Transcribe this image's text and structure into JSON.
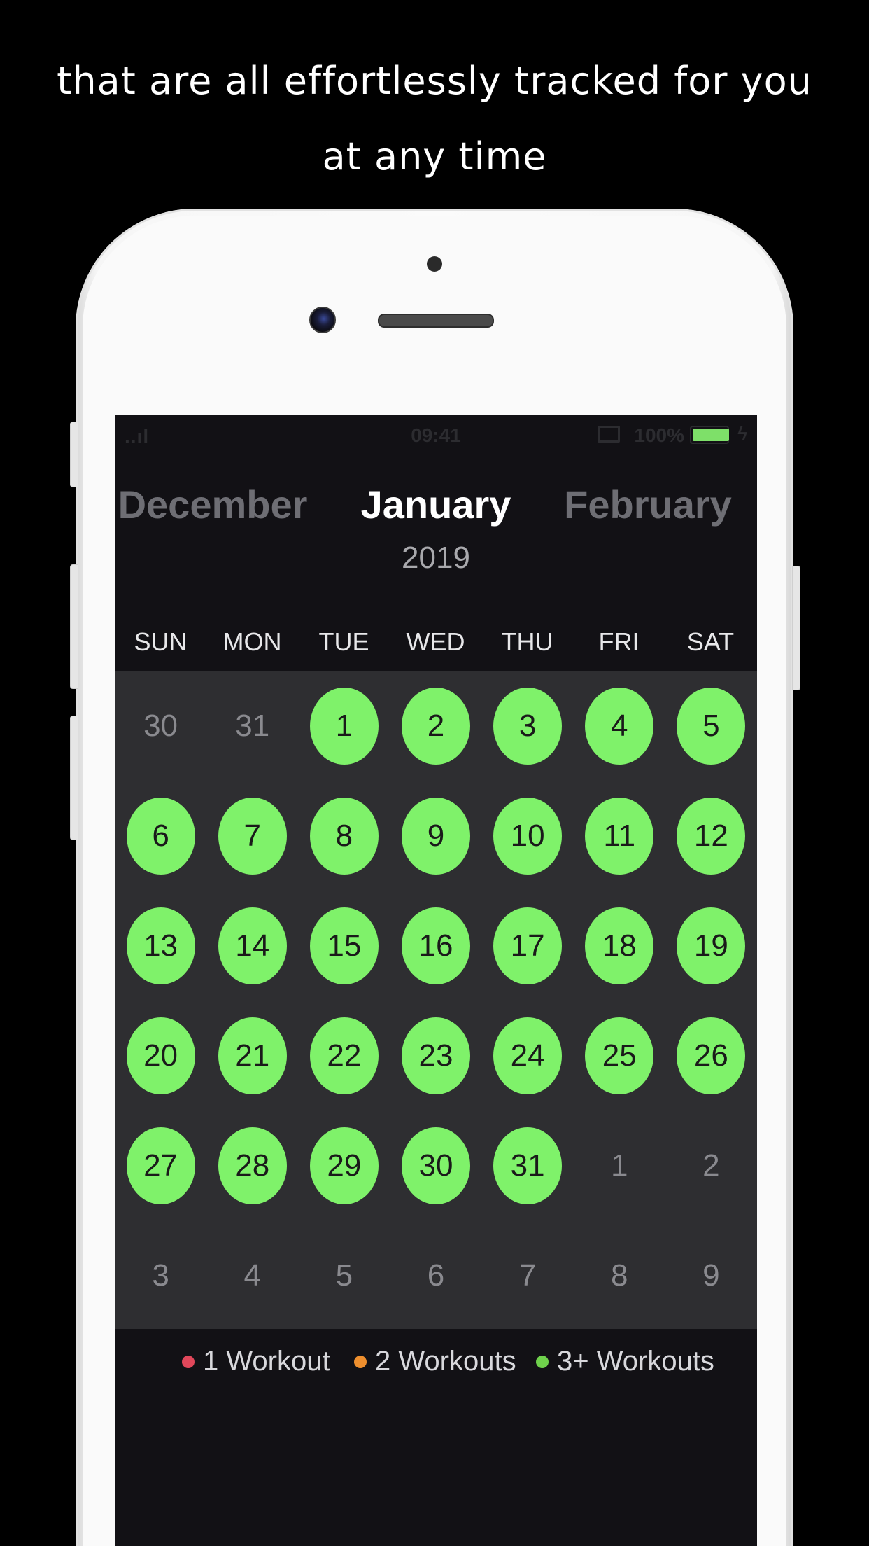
{
  "caption": {
    "line1": "that are all effortlessly tracked for you",
    "line2": "at any time"
  },
  "status_bar": {
    "signal": "..ıl",
    "time": "09:41",
    "battery": "100%"
  },
  "header": {
    "prev_month": "December",
    "current_month": "January",
    "next_month": "February",
    "year": "2019"
  },
  "weekdays": [
    "SUN",
    "MON",
    "TUE",
    "WED",
    "THU",
    "FRI",
    "SAT"
  ],
  "days": [
    {
      "label": "30",
      "active": false
    },
    {
      "label": "31",
      "active": false
    },
    {
      "label": "1",
      "active": true
    },
    {
      "label": "2",
      "active": true
    },
    {
      "label": "3",
      "active": true
    },
    {
      "label": "4",
      "active": true
    },
    {
      "label": "5",
      "active": true
    },
    {
      "label": "6",
      "active": true
    },
    {
      "label": "7",
      "active": true
    },
    {
      "label": "8",
      "active": true
    },
    {
      "label": "9",
      "active": true
    },
    {
      "label": "10",
      "active": true
    },
    {
      "label": "11",
      "active": true
    },
    {
      "label": "12",
      "active": true
    },
    {
      "label": "13",
      "active": true
    },
    {
      "label": "14",
      "active": true
    },
    {
      "label": "15",
      "active": true
    },
    {
      "label": "16",
      "active": true
    },
    {
      "label": "17",
      "active": true
    },
    {
      "label": "18",
      "active": true
    },
    {
      "label": "19",
      "active": true
    },
    {
      "label": "20",
      "active": true
    },
    {
      "label": "21",
      "active": true
    },
    {
      "label": "22",
      "active": true
    },
    {
      "label": "23",
      "active": true
    },
    {
      "label": "24",
      "active": true
    },
    {
      "label": "25",
      "active": true
    },
    {
      "label": "26",
      "active": true
    },
    {
      "label": "27",
      "active": true
    },
    {
      "label": "28",
      "active": true
    },
    {
      "label": "29",
      "active": true
    },
    {
      "label": "30",
      "active": true
    },
    {
      "label": "31",
      "active": true
    },
    {
      "label": "1",
      "active": false
    },
    {
      "label": "2",
      "active": false
    },
    {
      "label": "3",
      "active": false
    },
    {
      "label": "4",
      "active": false
    },
    {
      "label": "5",
      "active": false
    },
    {
      "label": "6",
      "active": false
    },
    {
      "label": "7",
      "active": false
    },
    {
      "label": "8",
      "active": false
    },
    {
      "label": "9",
      "active": false
    }
  ],
  "legend": [
    {
      "label": "1 Workout",
      "color": "#e0475a"
    },
    {
      "label": "2 Workouts",
      "color": "#ee8f2e"
    },
    {
      "label": "3+ Workouts",
      "color": "#6fd14c"
    }
  ],
  "colors": {
    "active_day": "#7ff26a",
    "grid_background": "#2e2e31",
    "screen_background": "#121115"
  }
}
